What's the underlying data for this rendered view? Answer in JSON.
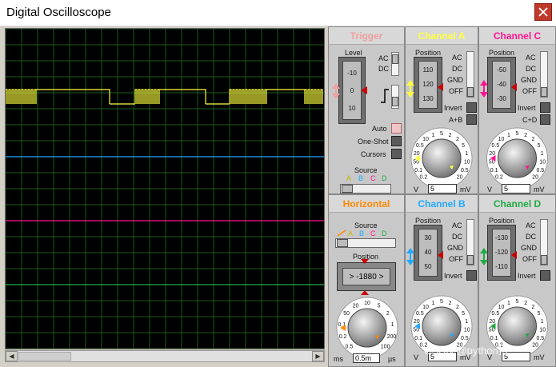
{
  "window": {
    "title": "Digital Oscilloscope"
  },
  "colors": {
    "chA": "#ffff40",
    "chB": "#22aaff",
    "chC": "#ff1493",
    "chD": "#22aa44",
    "trigger": "#f0a0a0",
    "horizontal": "#ff8800"
  },
  "trigger": {
    "title": "Trigger",
    "level_label": "Level",
    "level_ticks": [
      "-10",
      "0",
      "10"
    ],
    "coupling": [
      "AC",
      "DC"
    ],
    "modes": [
      "Auto",
      "One-Shot",
      "Cursors"
    ],
    "source_label": "Source",
    "sources": [
      "A",
      "B",
      "C",
      "D"
    ]
  },
  "horizontal": {
    "title": "Horizontal",
    "source_label": "Source",
    "sources": [
      "A",
      "B",
      "C",
      "D"
    ],
    "position_label": "Position",
    "position_value": "-1880",
    "dial_labels": [
      "0.5",
      "0.2",
      "0.1",
      "50",
      "20",
      "10",
      "5",
      "2",
      "1",
      "200",
      "100"
    ],
    "unit_left": "ms",
    "unit_right": "µs",
    "timebase_value": "0.5m"
  },
  "channels": [
    {
      "id": "A",
      "title": "Channel A",
      "ticks": [
        "110",
        "120",
        "130"
      ],
      "options": [
        "AC",
        "DC",
        "GND",
        "OFF"
      ],
      "invert": "Invert",
      "combine": "A+B",
      "value": "5"
    },
    {
      "id": "C",
      "title": "Channel C",
      "ticks": [
        "-50",
        "-40",
        "-30"
      ],
      "options": [
        "AC",
        "DC",
        "GND",
        "OFF"
      ],
      "invert": "Invert",
      "combine": "C+D",
      "value": "5"
    },
    {
      "id": "B",
      "title": "Channel B",
      "ticks": [
        "30",
        "40",
        "50"
      ],
      "options": [
        "AC",
        "DC",
        "GND",
        "OFF"
      ],
      "invert": "Invert",
      "combine": "",
      "value": "5"
    },
    {
      "id": "D",
      "title": "Channel D",
      "ticks": [
        "-130",
        "-120",
        "-110"
      ],
      "options": [
        "AC",
        "DC",
        "GND",
        "OFF"
      ],
      "invert": "Invert",
      "combine": "",
      "value": "5"
    }
  ],
  "channel_common": {
    "position_label": "Position",
    "dial_labels": [
      "0.2",
      "0.1",
      "50",
      "20",
      "0.5",
      "10",
      "1",
      "5",
      "2",
      "2",
      "5",
      "1",
      "10",
      "0.5",
      "20"
    ],
    "unit_left": "V",
    "unit_right": "mV"
  },
  "watermark": "CSDN @python拾"
}
